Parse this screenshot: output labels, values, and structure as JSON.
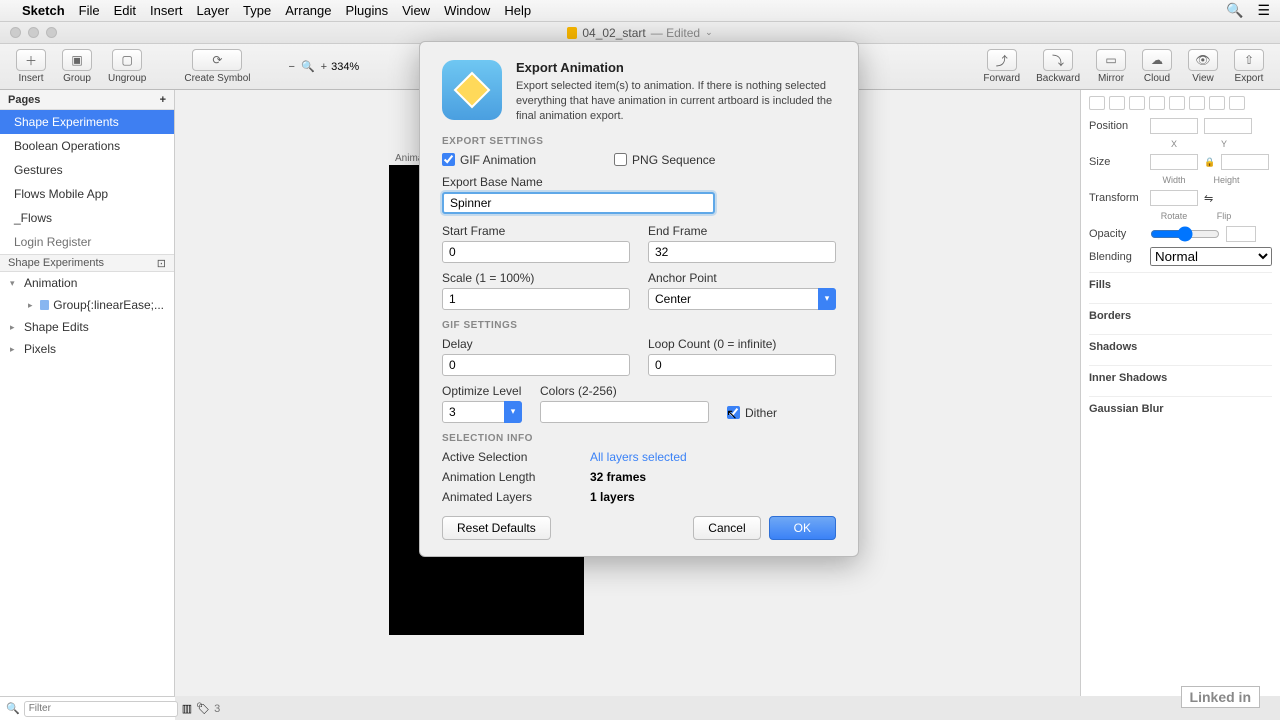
{
  "menubar": {
    "app": "Sketch",
    "items": [
      "File",
      "Edit",
      "Insert",
      "Layer",
      "Type",
      "Arrange",
      "Plugins",
      "View",
      "Window",
      "Help"
    ]
  },
  "titlebar": {
    "doc": "04_02_start",
    "state": "— Edited"
  },
  "toolbar": {
    "insert": "Insert",
    "group": "Group",
    "ungroup": "Ungroup",
    "create_symbol": "Create Symbol",
    "zoom": "334%",
    "forward": "Forward",
    "backward": "Backward",
    "mirror": "Mirror",
    "cloud": "Cloud",
    "view": "View",
    "export": "Export"
  },
  "pages": {
    "header": "Pages",
    "items": [
      "Shape Experiments",
      "Boolean Operations",
      "Gestures",
      "Flows Mobile App",
      "_Flows",
      "Login Register"
    ],
    "selected_index": 0
  },
  "layers": {
    "header": "Shape Experiments",
    "items": [
      {
        "label": "Animation",
        "type": "artboard",
        "expanded": true
      },
      {
        "label": "Group{:linearEase;...",
        "type": "group",
        "indent": 1
      },
      {
        "label": "Shape Edits",
        "type": "artboard"
      },
      {
        "label": "Pixels",
        "type": "artboard"
      }
    ]
  },
  "canvas": {
    "artboard_label": "Animation"
  },
  "inspector": {
    "position": "Position",
    "x": "X",
    "y": "Y",
    "size": "Size",
    "width": "Width",
    "height": "Height",
    "transform": "Transform",
    "rotate": "Rotate",
    "flip": "Flip",
    "opacity": "Opacity",
    "blending": "Blending",
    "blending_value": "Normal",
    "sections": [
      "Fills",
      "Borders",
      "Shadows",
      "Inner Shadows",
      "Gaussian Blur"
    ]
  },
  "filter": {
    "placeholder": "Filter",
    "count": "3"
  },
  "modal": {
    "title": "Export Animation",
    "desc": "Export selected item(s) to animation. If there is nothing selected everything that have animation in current artboard is included the final animation export.",
    "sec_export": "EXPORT SETTINGS",
    "gif_label": "GIF Animation",
    "gif_checked": true,
    "png_label": "PNG Sequence",
    "png_checked": false,
    "basename_label": "Export Base Name",
    "basename_value": "Spinner",
    "start_label": "Start Frame",
    "start_value": "0",
    "end_label": "End Frame",
    "end_value": "32",
    "scale_label": "Scale (1 = 100%)",
    "scale_value": "1",
    "anchor_label": "Anchor Point",
    "anchor_value": "Center",
    "sec_gif": "GIF SETTINGS",
    "delay_label": "Delay",
    "delay_value": "0",
    "loop_label": "Loop Count (0 = infinite)",
    "loop_value": "0",
    "optimize_label": "Optimize Level",
    "optimize_value": "3",
    "colors_label": "Colors (2-256)",
    "colors_value": "",
    "dither_label": "Dither",
    "dither_checked": true,
    "sec_sel": "SELECTION INFO",
    "activesel_k": "Active Selection",
    "activesel_v": "All layers selected",
    "animlen_k": "Animation Length",
    "animlen_v": "32 frames",
    "animlay_k": "Animated Layers",
    "animlay_v": "1 layers",
    "reset": "Reset Defaults",
    "cancel": "Cancel",
    "ok": "OK"
  },
  "watermark": "Linked in"
}
